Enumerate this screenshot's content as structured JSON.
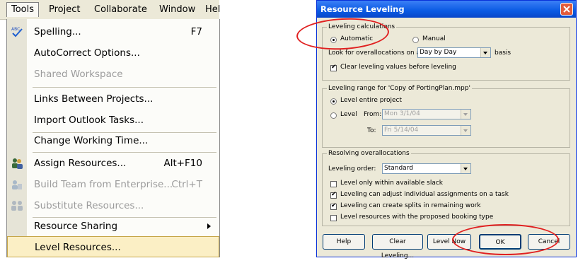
{
  "menubar": {
    "items": [
      "Tools",
      "Project",
      "Collaborate",
      "Window",
      "Hel"
    ]
  },
  "tools_menu": {
    "items": [
      {
        "label": "Spelling...",
        "shortcut": "F7",
        "icon": "spelling-icon",
        "enabled": true
      },
      {
        "label": "AutoCorrect Options...",
        "shortcut": "",
        "icon": "",
        "enabled": true
      },
      {
        "label": "Shared Workspace",
        "shortcut": "",
        "icon": "",
        "enabled": false
      },
      {
        "label": "Links Between Projects...",
        "shortcut": "",
        "icon": "",
        "enabled": true
      },
      {
        "label": "Import Outlook Tasks...",
        "shortcut": "",
        "icon": "",
        "enabled": true
      },
      {
        "label": "Change Working Time...",
        "shortcut": "",
        "icon": "",
        "enabled": true
      },
      {
        "label": "Assign Resources...",
        "shortcut": "Alt+F10",
        "icon": "assign-resources-icon",
        "enabled": true
      },
      {
        "label": "Build Team from Enterprise...",
        "shortcut": "Ctrl+T",
        "icon": "build-team-icon",
        "enabled": false
      },
      {
        "label": "Substitute Resources...",
        "shortcut": "",
        "icon": "substitute-resources-icon",
        "enabled": false
      },
      {
        "label": "Resource Sharing",
        "shortcut": "",
        "icon": "",
        "enabled": true,
        "submenu": true
      },
      {
        "label": "Level Resources...",
        "shortcut": "",
        "icon": "",
        "enabled": true,
        "highlighted": true
      }
    ]
  },
  "dialog": {
    "title": "Resource Leveling",
    "calc": {
      "group_label": "Leveling calculations",
      "automatic_label": "Automatic",
      "manual_label": "Manual",
      "selected": "Automatic",
      "overalloc_prefix": "Look for overallocations on a",
      "overalloc_value": "Day by Day",
      "overalloc_suffix": "basis",
      "clear_label": "Clear leveling values before leveling",
      "clear_checked": true
    },
    "range": {
      "group_label": "Leveling range for 'Copy of PortingPlan.mpp'",
      "entire_label": "Level entire project",
      "level_label": "Level",
      "from_label": "From:",
      "from_value": "Mon 3/1/04",
      "to_label": "To:",
      "to_value": "Fri 5/14/04",
      "selected": "Level entire project"
    },
    "resolve": {
      "group_label": "Resolving overallocations",
      "order_label": "Leveling order:",
      "order_value": "Standard",
      "options": [
        {
          "label": "Level only within available slack",
          "checked": false
        },
        {
          "label": "Leveling can adjust individual assignments on a task",
          "checked": true
        },
        {
          "label": "Leveling can create splits in remaining work",
          "checked": true
        },
        {
          "label": "Level resources with the proposed booking type",
          "checked": false
        }
      ]
    },
    "buttons": {
      "help": "Help",
      "clear": "Clear Leveling...",
      "level_now": "Level Now",
      "ok": "OK",
      "cancel": "Cancel"
    }
  },
  "colors": {
    "annotation": "#e02020",
    "titlebar": "#0a5ae3",
    "highlight": "#fbefc5"
  }
}
